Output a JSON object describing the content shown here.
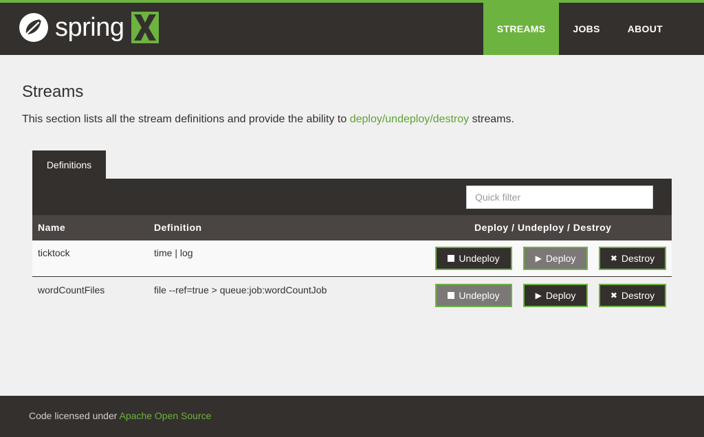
{
  "brand": {
    "name": "spring",
    "accent": "#6db33f",
    "dark": "#34302d"
  },
  "nav": [
    {
      "label": "STREAMS",
      "active": true
    },
    {
      "label": "JOBS",
      "active": false
    },
    {
      "label": "ABOUT",
      "active": false
    }
  ],
  "page": {
    "title": "Streams",
    "intro_prefix": "This section lists all the stream definitions and provide the ability to ",
    "intro_link": "deploy/undeploy/destroy",
    "intro_suffix": " streams."
  },
  "tabs": [
    {
      "label": "Definitions",
      "active": true
    }
  ],
  "filter": {
    "placeholder": "Quick filter",
    "value": ""
  },
  "table": {
    "headers": {
      "name": "Name",
      "definition": "Definition",
      "actions": "Deploy / Undeploy / Destroy"
    },
    "rows": [
      {
        "name": "ticktock",
        "definition": "time | log",
        "undeploy": {
          "label": "Undeploy",
          "enabled": true
        },
        "deploy": {
          "label": "Deploy",
          "enabled": false
        },
        "destroy": {
          "label": "Destroy",
          "enabled": true
        }
      },
      {
        "name": "wordCountFiles",
        "definition": "file --ref=true > queue:job:wordCountJob",
        "undeploy": {
          "label": "Undeploy",
          "enabled": false
        },
        "deploy": {
          "label": "Deploy",
          "enabled": true
        },
        "destroy": {
          "label": "Destroy",
          "enabled": true
        }
      }
    ]
  },
  "icons": {
    "undeploy": "stop-square-icon",
    "deploy": "play-icon",
    "destroy": "close-x-icon"
  },
  "footer": {
    "prefix": "Code licensed under ",
    "link": "Apache Open Source"
  }
}
